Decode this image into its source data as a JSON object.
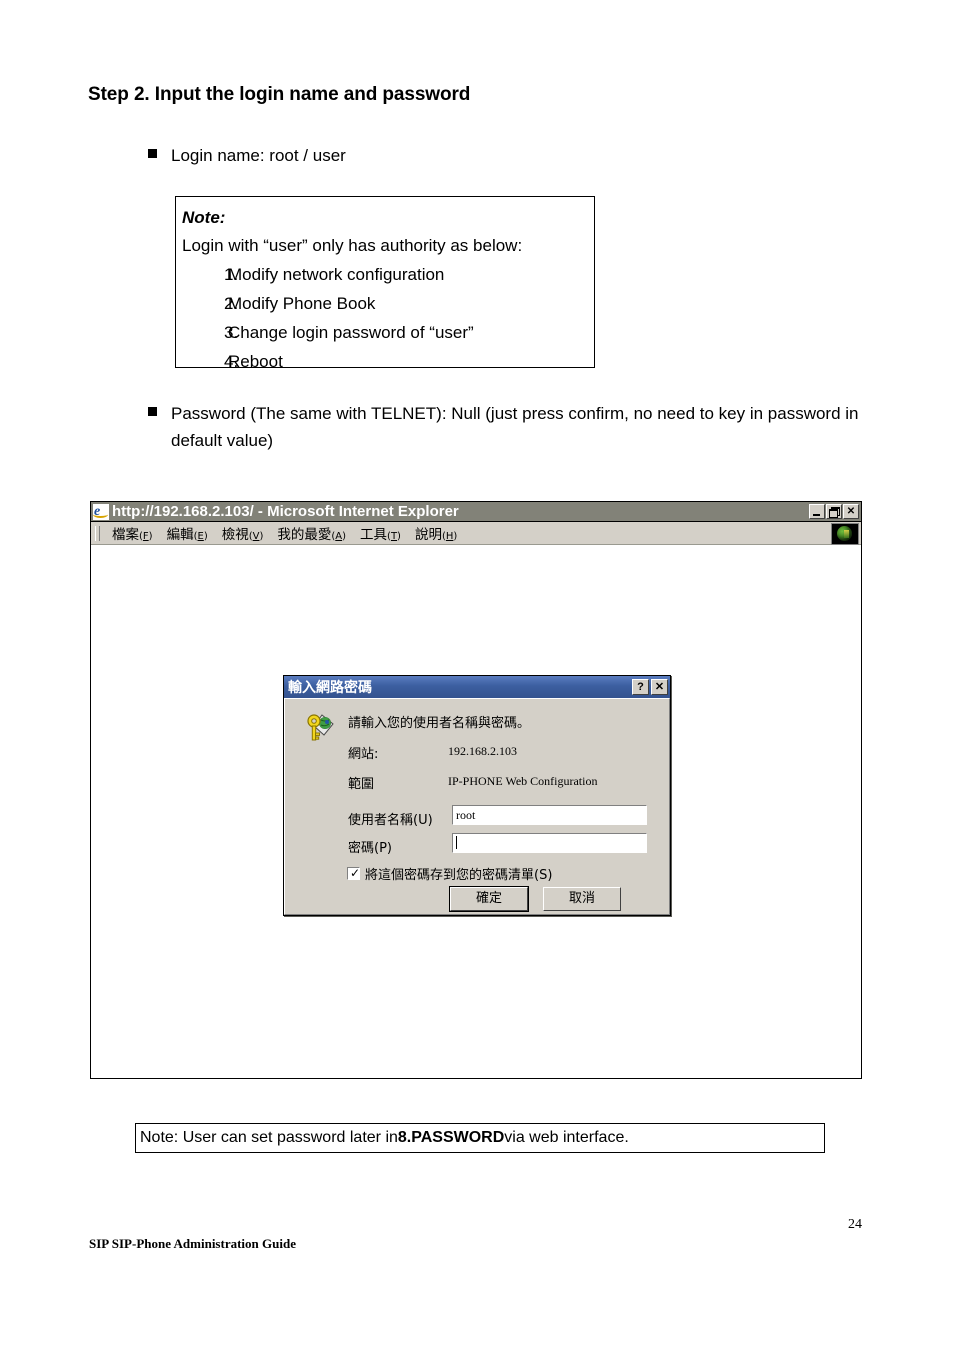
{
  "document": {
    "heading": "Step 2. Input the login name and password",
    "bullets": {
      "login_name": "Login name: root / user",
      "password": "Password (The same with TELNET): Null (just press confirm, no need to key in password in default value)"
    },
    "note_box": {
      "title": "Note:",
      "lead": "Login with “user” only has authority as below:",
      "items": [
        {
          "num": "1.",
          "text": "Modify network configuration"
        },
        {
          "num": "2.",
          "text": "Modify Phone Book"
        },
        {
          "num": "3.",
          "text": "Change login password of “user”"
        },
        {
          "num": "4.",
          "text": "Reboot"
        }
      ]
    },
    "bottom_note": {
      "prefix": "Note: User can set password later in ",
      "emphasis": "8.PASSWORD",
      "suffix": " via web interface."
    },
    "footer": {
      "left": "SIP SIP-Phone    Administration Guide",
      "page_number": "24"
    }
  },
  "browser": {
    "title": "http://192.168.2.103/ - Microsoft Internet Explorer",
    "app_icon": "internet-explorer-icon",
    "window_buttons": [
      {
        "name": "minimize",
        "glyph": "_"
      },
      {
        "name": "restore",
        "glyph": "❐"
      },
      {
        "name": "close",
        "glyph": "✕"
      }
    ],
    "menu": [
      {
        "label": "檔案",
        "mnemonic": "F"
      },
      {
        "label": "編輯",
        "mnemonic": "E"
      },
      {
        "label": "檢視",
        "mnemonic": "V"
      },
      {
        "label": "我的最愛",
        "mnemonic": "A"
      },
      {
        "label": "工具",
        "mnemonic": "T"
      },
      {
        "label": "說明",
        "mnemonic": "H"
      }
    ],
    "brand_logo": "ie-globe-logo"
  },
  "dialog": {
    "title": "輸入網路密碼",
    "help_button": "?",
    "close_button": "✕",
    "icon": "key-and-globe-icon",
    "prompt": "請輸入您的使用者名稱與密碼。",
    "site_label": "網站:",
    "site_value": "192.168.2.103",
    "realm_label": "範圍",
    "realm_value": "IP-PHONE Web Configuration",
    "username_label": "使用者名稱(U)",
    "username_value": "root",
    "password_label": "密碼(P)",
    "password_value": "",
    "save_checkbox_label": "將這個密碼存到您的密碼清單(S)",
    "save_checkbox_checked": true,
    "ok_button": "確定",
    "cancel_button": "取消"
  },
  "colors": {
    "dialog_titlebar": "#3c5fa0",
    "window_chrome": "#d4d0c8",
    "browser_titlebar": "#828278"
  }
}
